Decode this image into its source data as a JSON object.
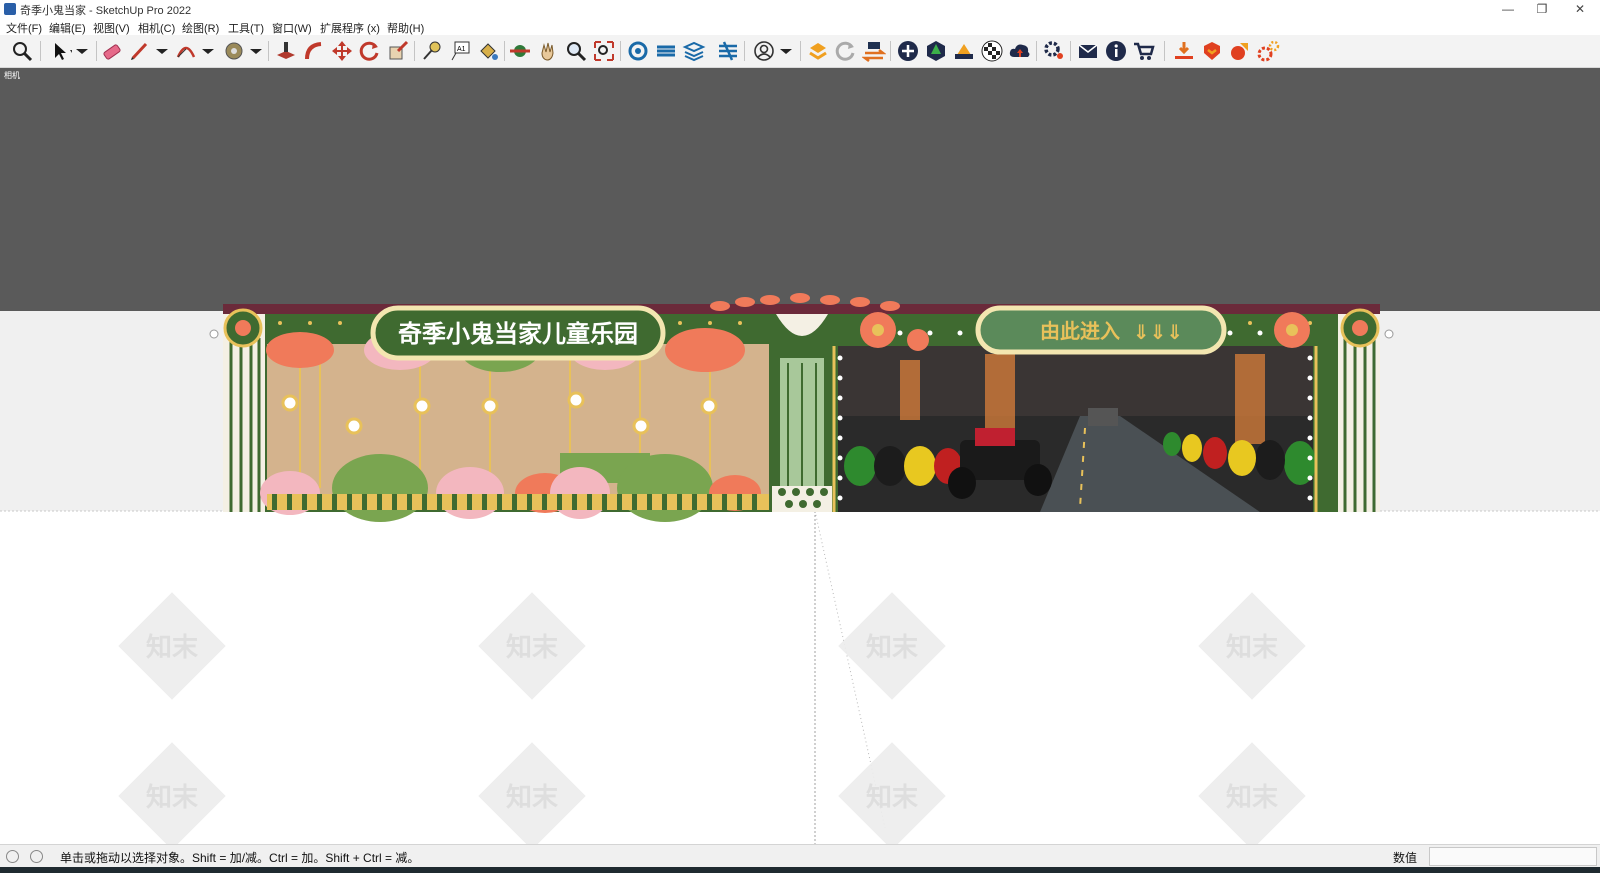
{
  "window": {
    "title": "奇季小鬼当家 - SketchUp Pro 2022",
    "controls": {
      "minimize": "—",
      "restore": "❐",
      "close": "✕"
    }
  },
  "menu": {
    "items": [
      {
        "label": "文件(F)"
      },
      {
        "label": "编辑(E)"
      },
      {
        "label": "视图(V)"
      },
      {
        "label": "相机(C)"
      },
      {
        "label": "绘图(R)"
      },
      {
        "label": "工具(T)"
      },
      {
        "label": "窗口(W)"
      },
      {
        "label": "扩展程序 (x)"
      },
      {
        "label": "帮助(H)"
      }
    ]
  },
  "toolbar": {
    "tools": [
      {
        "name": "zoom-extents-icon"
      },
      {
        "name": "select-icon"
      },
      {
        "name": "eraser-icon"
      },
      {
        "name": "pencil-line-icon"
      },
      {
        "name": "arc-icon"
      },
      {
        "name": "shape-icon"
      },
      {
        "name": "push-pull-icon"
      },
      {
        "name": "follow-me-icon"
      },
      {
        "name": "move-icon"
      },
      {
        "name": "rotate-icon"
      },
      {
        "name": "scale-icon"
      },
      {
        "name": "tape-measure-icon"
      },
      {
        "name": "text-icon"
      },
      {
        "name": "paint-bucket-icon"
      },
      {
        "name": "orbit-icon"
      },
      {
        "name": "pan-icon"
      },
      {
        "name": "zoom-icon"
      },
      {
        "name": "zoom-window-icon"
      },
      {
        "name": "warehouse-icon"
      },
      {
        "name": "extension-icon"
      },
      {
        "name": "layers-icon"
      },
      {
        "name": "sandbox-icon"
      },
      {
        "name": "account-icon"
      },
      {
        "name": "layout-icon"
      },
      {
        "name": "refresh-icon"
      },
      {
        "name": "transfer-icon"
      },
      {
        "name": "add-circle-icon"
      },
      {
        "name": "tree-icon"
      },
      {
        "name": "section-icon"
      },
      {
        "name": "checker-icon"
      },
      {
        "name": "cloud-upload-icon"
      },
      {
        "name": "settings-icon"
      },
      {
        "name": "mail-icon"
      },
      {
        "name": "info-icon"
      },
      {
        "name": "cart-icon"
      },
      {
        "name": "download-tray-icon"
      },
      {
        "name": "plugin-shield-icon"
      },
      {
        "name": "plugin-rocket-icon"
      },
      {
        "name": "plugin-gears-icon"
      }
    ]
  },
  "viewport": {
    "scene_label": "相机",
    "banner_left_text": "奇季小鬼当家儿童乐园",
    "banner_right_text": "由此进入",
    "banner_arrows": "⇓⇓⇓",
    "watermark_text": "知末"
  },
  "status": {
    "prompt": "单击或拖动以选择对象。Shift = 加/减。Ctrl = 加。Shift + Ctrl = 减。",
    "vcb_label": "数值",
    "vcb_value": ""
  },
  "colors": {
    "sky": "#5a5a5a",
    "facade_green": "#3f6a30",
    "accent_gold": "#e8c15a",
    "accent_coral": "#f07a5a",
    "accent_pink": "#f3b7bf"
  }
}
